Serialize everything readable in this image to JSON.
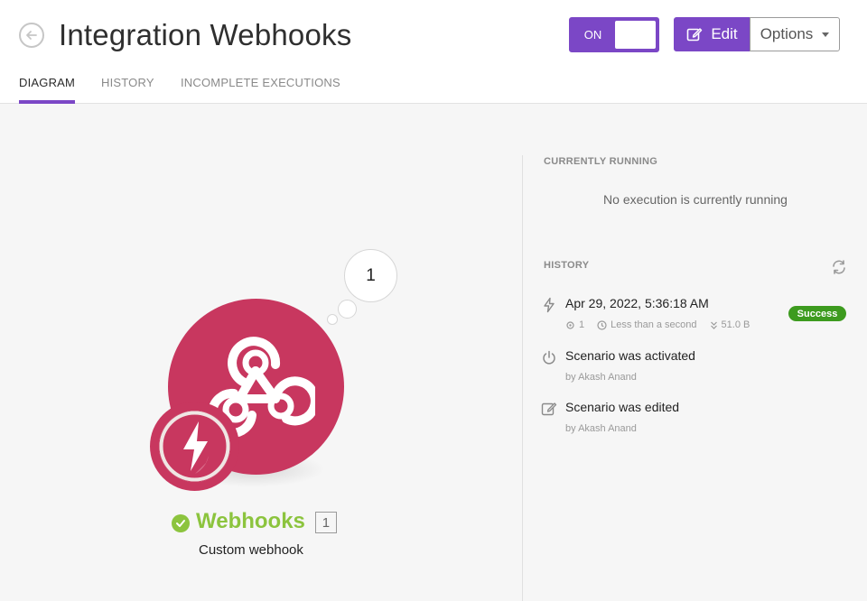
{
  "header": {
    "title": "Integration Webhooks",
    "toggle_label": "ON",
    "edit_label": "Edit",
    "options_label": "Options"
  },
  "tabs": [
    {
      "label": "DIAGRAM",
      "active": true
    },
    {
      "label": "HISTORY",
      "active": false
    },
    {
      "label": "INCOMPLETE EXECUTIONS",
      "active": false
    }
  ],
  "module": {
    "bubble_count": "1",
    "name": "Webhooks",
    "count": "1",
    "subtitle": "Custom webhook",
    "color": "#c8375f",
    "status_color": "#8cc43e"
  },
  "currently_running": {
    "title": "CURRENTLY RUNNING",
    "message": "No execution is currently running"
  },
  "history": {
    "title": "HISTORY",
    "items": [
      {
        "icon": "lightning-icon",
        "title": "Apr 29, 2022, 5:36:18 AM",
        "operations": "1",
        "duration": "Less than a second",
        "size": "51.0 B",
        "badge": "Success"
      },
      {
        "icon": "power-icon",
        "title": "Scenario was activated",
        "by": "by Akash Anand"
      },
      {
        "icon": "edit-icon",
        "title": "Scenario was edited",
        "by": "by Akash Anand"
      }
    ]
  },
  "colors": {
    "accent": "#7b47c6",
    "success": "#3d9b1f"
  }
}
